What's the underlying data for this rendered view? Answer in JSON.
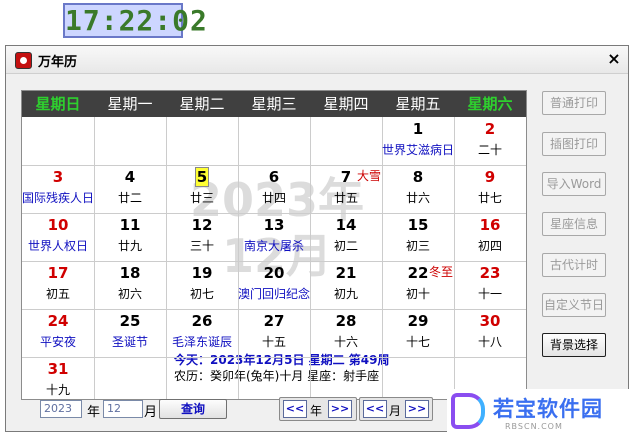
{
  "clock": "17:22:02",
  "window": {
    "title": "万年历",
    "close_glyph": "×"
  },
  "weekdays": [
    "星期日",
    "星期一",
    "星期二",
    "星期三",
    "星期四",
    "星期五",
    "星期六"
  ],
  "watermark": {
    "year": "2023年",
    "month": "12月"
  },
  "days": [
    {
      "day": "1",
      "sub": "世界艾滋病日",
      "sub_blue": true
    },
    {
      "day": "2",
      "sub": "二十"
    },
    {
      "day": "3",
      "sub": "国际残疾人日",
      "sub_blue": true
    },
    {
      "day": "4",
      "sub": "廿二"
    },
    {
      "day": "5",
      "sub": "廿三",
      "today": true
    },
    {
      "day": "6",
      "sub": "廿四"
    },
    {
      "day": "7",
      "sub": "廿五",
      "term": "大雪"
    },
    {
      "day": "8",
      "sub": "廿六"
    },
    {
      "day": "9",
      "sub": "廿七"
    },
    {
      "day": "10",
      "sub": "世界人权日",
      "sub_blue": true
    },
    {
      "day": "11",
      "sub": "廿九"
    },
    {
      "day": "12",
      "sub": "三十"
    },
    {
      "day": "13",
      "sub": "南京大屠杀",
      "sub_blue": true
    },
    {
      "day": "14",
      "sub": "初二"
    },
    {
      "day": "15",
      "sub": "初三"
    },
    {
      "day": "16",
      "sub": "初四"
    },
    {
      "day": "17",
      "sub": "初五"
    },
    {
      "day": "18",
      "sub": "初六"
    },
    {
      "day": "19",
      "sub": "初七"
    },
    {
      "day": "20",
      "sub": "澳门回归纪念",
      "sub_blue": true
    },
    {
      "day": "21",
      "sub": "初九"
    },
    {
      "day": "22",
      "sub": "初十",
      "term": "冬至"
    },
    {
      "day": "23",
      "sub": "十一"
    },
    {
      "day": "24",
      "sub": "平安夜",
      "sub_blue": true
    },
    {
      "day": "25",
      "sub": "圣诞节",
      "sub_blue": true
    },
    {
      "day": "26",
      "sub": "毛泽东诞辰",
      "sub_blue": true
    },
    {
      "day": "27",
      "sub": "十五"
    },
    {
      "day": "28",
      "sub": "十六"
    },
    {
      "day": "29",
      "sub": "十七"
    },
    {
      "day": "30",
      "sub": "十八"
    },
    {
      "day": "31",
      "sub": "十九"
    }
  ],
  "today_info": {
    "line1": "今天：2023年12月5日  星期二  第49周",
    "line2": "农历：癸卯年(兔年)十月   星座：射手座"
  },
  "bottom": {
    "year_value": "2023",
    "year_label": "年",
    "month_value": "12",
    "month_label": "月",
    "query_label": "查询",
    "prev": "<<",
    "next": ">>",
    "nav_year_label": "年",
    "nav_month_label": "月"
  },
  "side_buttons": [
    {
      "label": "普通打印",
      "active": false
    },
    {
      "label": "插图打印",
      "active": false
    },
    {
      "label": "导入Word",
      "active": false
    },
    {
      "label": "星座信息",
      "active": false
    },
    {
      "label": "古代计时",
      "active": false
    },
    {
      "label": "自定义节日",
      "active": false
    },
    {
      "label": "背景选择",
      "active": true
    }
  ],
  "logo": {
    "text": "若宝软件园",
    "url": "RBSCN.COM"
  },
  "colors": {
    "weekend_header": "#2ed02e",
    "red_day": "#d00000",
    "blue_text": "#1010c0",
    "today_highlight": "#ffff33"
  }
}
